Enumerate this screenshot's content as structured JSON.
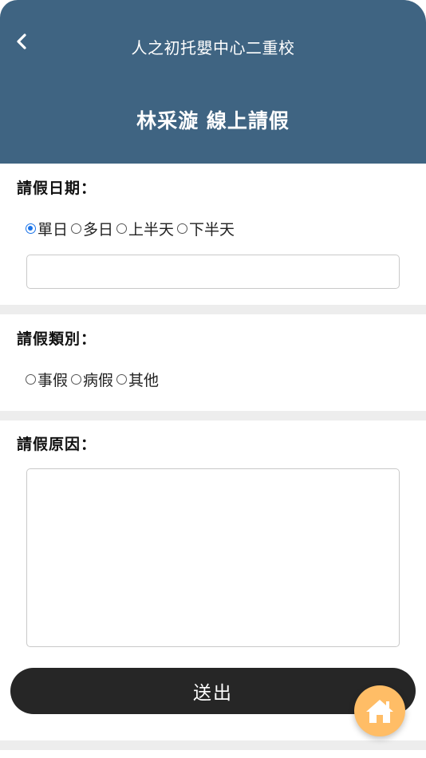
{
  "header": {
    "back_icon": "chevron-left-icon",
    "school_name": "人之初托嬰中心二重校",
    "page_title": "林采漩 線上請假"
  },
  "leave_date": {
    "label": "請假日期：",
    "options": [
      "單日",
      "多日",
      "上半天",
      "下半天"
    ],
    "selected": "單日",
    "input_value": ""
  },
  "leave_type": {
    "label": "請假類別：",
    "options": [
      "事假",
      "病假",
      "其他"
    ],
    "selected": ""
  },
  "leave_reason": {
    "label": "請假原因：",
    "value": ""
  },
  "submit_label": "送出",
  "home_icon": "home-icon",
  "colors": {
    "header_bg": "#3f6482",
    "submit_bg": "#262626",
    "fab_bg": "#ffbd66",
    "divider": "#ededed",
    "radio_checked": "#1a73e8"
  }
}
